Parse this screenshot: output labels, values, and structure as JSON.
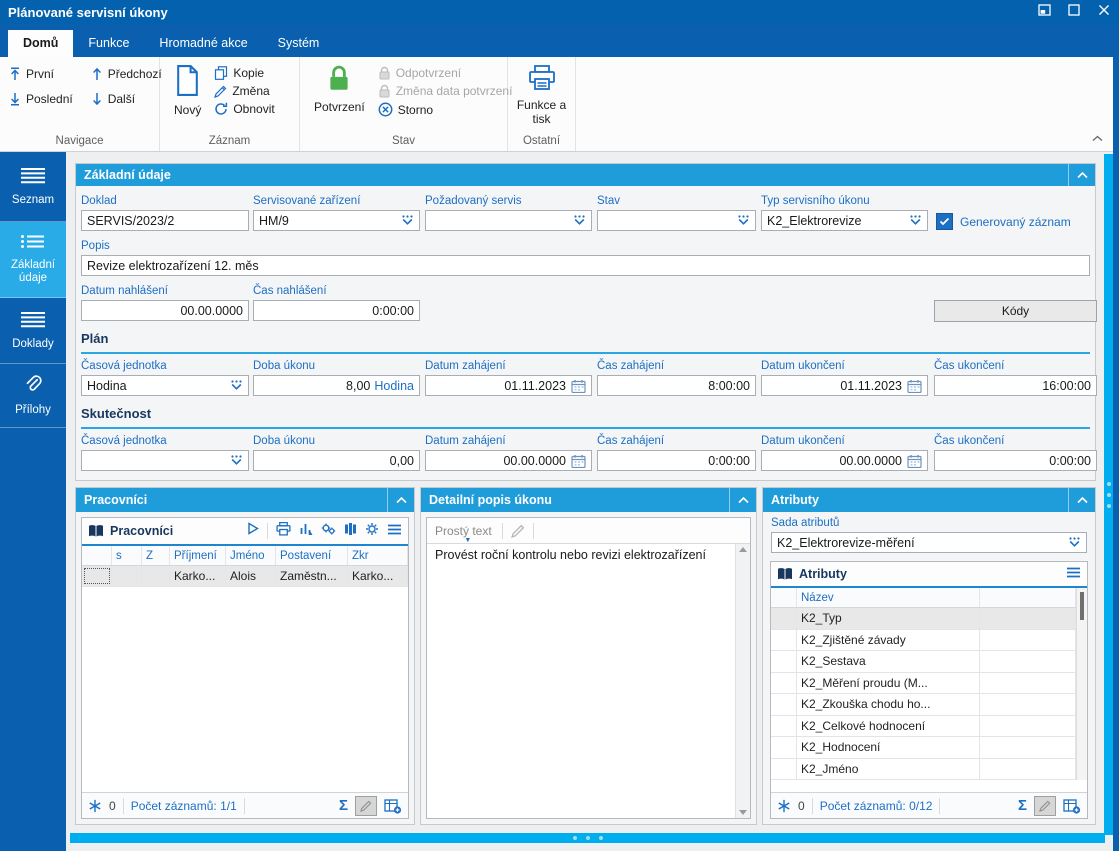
{
  "colors": {
    "titlebar_blue": "#0361ad",
    "ribbon_blue": "#0a60ae",
    "panel_header_cyan": "#1f9ddb",
    "splitter_cyan": "#00aeef",
    "active_nav_cyan": "#29abe8",
    "label_blue": "#1d6fc4",
    "section_navy": "#17375e",
    "confirm_green": "#4cb050"
  },
  "window": {
    "title": "Plánované servisní úkony"
  },
  "ribbon": {
    "tabs": [
      {
        "label": "Domů"
      },
      {
        "label": "Funkce"
      },
      {
        "label": "Hromadné akce"
      },
      {
        "label": "Systém"
      }
    ],
    "groups": {
      "navigace": {
        "label": "Navigace",
        "prvni": "První",
        "posledni": "Poslední",
        "predchozi": "Předchozí",
        "dalsi": "Další"
      },
      "zaznam": {
        "label": "Záznam",
        "novy": "Nový",
        "kopie": "Kopie",
        "zmena": "Změna",
        "obnovit": "Obnovit"
      },
      "stav": {
        "label": "Stav",
        "potvrzeni": "Potvrzení",
        "odpotvrzeni": "Odpotvrzení",
        "zmena_data": "Změna data potvrzení",
        "storno": "Storno"
      },
      "ostatni": {
        "label": "Ostatní",
        "funkce_tisk": "Funkce a tisk"
      }
    }
  },
  "sidebar": {
    "items": [
      {
        "label": "Seznam"
      },
      {
        "label": "Základní údaje"
      },
      {
        "label": "Doklady"
      },
      {
        "label": "Přílohy"
      }
    ]
  },
  "basic": {
    "title": "Základní údaje",
    "doklad": {
      "label": "Doklad",
      "value": "SERVIS/2023/2"
    },
    "zarizeni": {
      "label": "Servisované zařízení",
      "value": "HM/9"
    },
    "pozadovany": {
      "label": "Požadovaný servis",
      "value": ""
    },
    "stav": {
      "label": "Stav",
      "value": ""
    },
    "typ": {
      "label": "Typ servisního úkonu",
      "value": "K2_Elektrorevize"
    },
    "generovany": {
      "label": "Generovaný záznam"
    },
    "popis": {
      "label": "Popis",
      "value": "Revize elektrozařízení 12. měs"
    },
    "datum_nahlaseni": {
      "label": "Datum nahlášení",
      "value": "00.00.0000"
    },
    "cas_nahlaseni": {
      "label": "Čas nahlášení",
      "value": "0:00:00"
    },
    "kody": "Kódy",
    "plan": {
      "title": "Plán",
      "jednotka": {
        "label": "Časová jednotka",
        "value": "Hodina"
      },
      "doba": {
        "label": "Doba úkonu",
        "value": "8,00",
        "unit": "Hodina"
      },
      "datum_zahajeni": {
        "label": "Datum zahájení",
        "value": "01.11.2023"
      },
      "cas_zahajeni": {
        "label": "Čas zahájení",
        "value": "8:00:00"
      },
      "datum_ukonceni": {
        "label": "Datum ukončení",
        "value": "01.11.2023"
      },
      "cas_ukonceni": {
        "label": "Čas ukončení",
        "value": "16:00:00"
      }
    },
    "skutecnost": {
      "title": "Skutečnost",
      "jednotka": {
        "label": "Časová jednotka",
        "value": ""
      },
      "doba": {
        "label": "Doba úkonu",
        "value": "0,00",
        "unit": ""
      },
      "datum_zahajeni": {
        "label": "Datum zahájení",
        "value": "00.00.0000"
      },
      "cas_zahajeni": {
        "label": "Čas zahájení",
        "value": "0:00:00"
      },
      "datum_ukonceni": {
        "label": "Datum ukončení",
        "value": "00.00.0000"
      },
      "cas_ukonceni": {
        "label": "Čas ukončení",
        "value": "0:00:00"
      }
    }
  },
  "pracovnici": {
    "title": "Pracovníci",
    "grid_title": "Pracovníci",
    "columns": [
      "",
      "s",
      "Z",
      "Příjmení",
      "Jméno",
      "Postavení",
      "Zkr"
    ],
    "rows": [
      {
        "prijmeni": "Karko...",
        "jmeno": "Alois",
        "postaveni": "Zaměstn...",
        "zkr": "Karko..."
      }
    ],
    "status": {
      "badge": "0",
      "count": "Počet záznamů: 1/1",
      "sum": "Σ"
    }
  },
  "detail": {
    "title": "Detailní popis úkonu",
    "mode": "Prostý text",
    "text": "Provést roční kontrolu nebo revizi elektrozařízení"
  },
  "atributy": {
    "title": "Atributy",
    "sada": {
      "label": "Sada atributů",
      "value": "K2_Elektrorevize-měření"
    },
    "grid_title": "Atributy",
    "name_column": "Název",
    "rows": [
      "K2_Typ",
      "K2_Zjištěné závady",
      "K2_Sestava",
      "K2_Měření proudu (M...",
      "K2_Zkouška chodu ho...",
      "K2_Celkové hodnocení",
      "K2_Hodnocení",
      "K2_Jméno"
    ],
    "status": {
      "badge": "0",
      "count": "Počet záznamů: 0/12",
      "sum": "Σ"
    }
  }
}
